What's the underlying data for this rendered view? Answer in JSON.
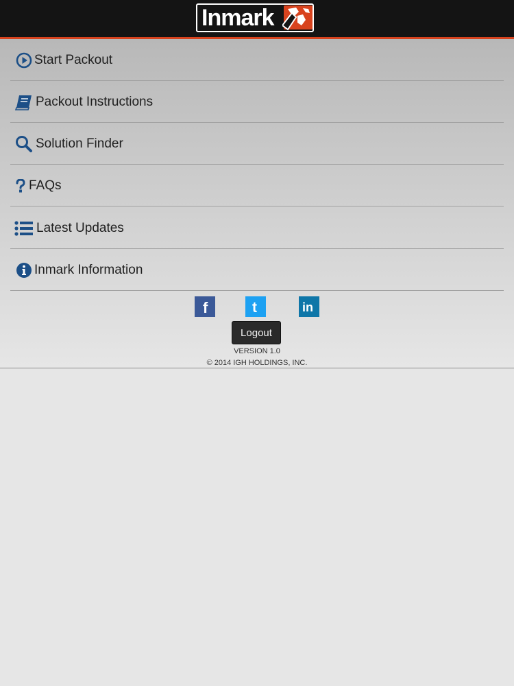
{
  "header": {
    "logo_text": "Inmark",
    "accent_color": "#d8431e"
  },
  "menu": {
    "items": [
      {
        "label": "Start Packout",
        "icon": "play-circle-icon"
      },
      {
        "label": "Packout Instructions",
        "icon": "book-icon"
      },
      {
        "label": "Solution Finder",
        "icon": "search-icon"
      },
      {
        "label": "FAQs",
        "icon": "question-icon"
      },
      {
        "label": "Latest Updates",
        "icon": "list-icon"
      },
      {
        "label": "Inmark Information",
        "icon": "info-circle-icon"
      }
    ],
    "icon_color": "#1c4f87"
  },
  "social": {
    "facebook": {
      "glyph": "f",
      "color": "#3b5998"
    },
    "twitter": {
      "glyph": "t",
      "color": "#1da1f2"
    },
    "linkedin": {
      "glyph": "in",
      "color": "#0e76a8"
    }
  },
  "footer": {
    "logout_label": "Logout",
    "version": "VERSION 1.0",
    "copyright": "© 2014 IGH HOLDINGS, INC."
  }
}
